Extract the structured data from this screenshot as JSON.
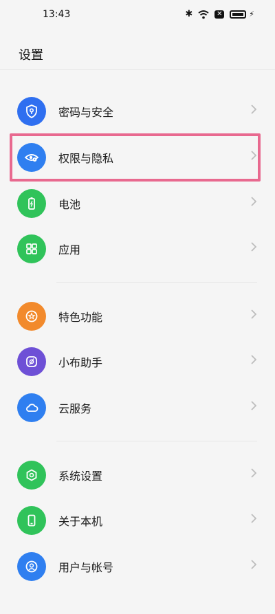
{
  "status_bar": {
    "time": "13:43"
  },
  "header": {
    "title": "设置"
  },
  "colors": {
    "blue": "#2f6ff0",
    "green": "#30c35a",
    "orange": "#f28a2c",
    "purple": "#6e50d6",
    "highlight": "#e8698f"
  },
  "items": [
    {
      "label": "密码与安全",
      "icon": "shield-key-icon",
      "color": "#2f6ff0"
    },
    {
      "label": "权限与隐私",
      "icon": "eye-privacy-icon",
      "color": "#2f7ff0"
    },
    {
      "label": "电池",
      "icon": "battery-icon",
      "color": "#30c35a"
    },
    {
      "label": "应用",
      "icon": "apps-grid-icon",
      "color": "#30c35a"
    },
    {
      "label": "特色功能",
      "icon": "star-badge-icon",
      "color": "#f28a2c"
    },
    {
      "label": "小布助手",
      "icon": "assistant-icon",
      "color": "#6e50d6"
    },
    {
      "label": "云服务",
      "icon": "cloud-icon",
      "color": "#2f7ff0"
    },
    {
      "label": "系统设置",
      "icon": "hexagon-settings-icon",
      "color": "#30c35a"
    },
    {
      "label": "关于本机",
      "icon": "phone-icon",
      "color": "#30c35a"
    },
    {
      "label": "用户与帐号",
      "icon": "user-account-icon",
      "color": "#2f7ff0"
    }
  ]
}
